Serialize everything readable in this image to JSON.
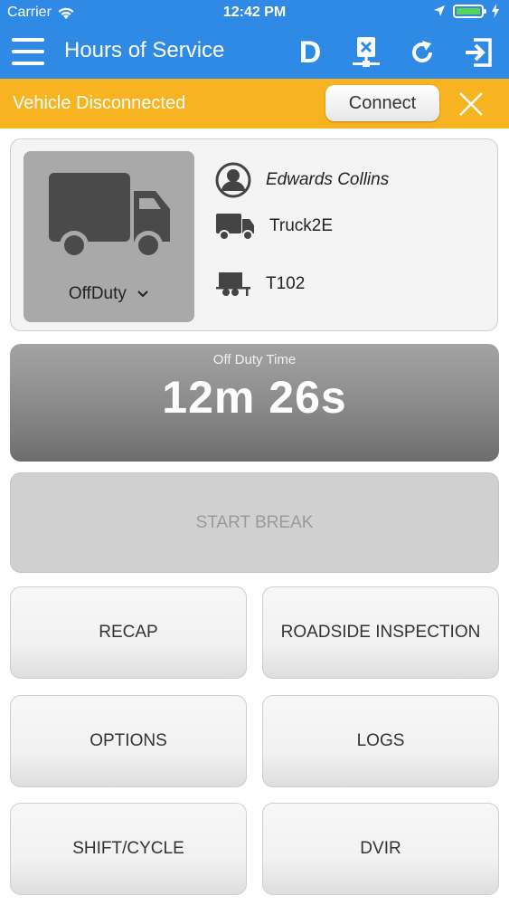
{
  "status_bar": {
    "carrier": "Carrier",
    "time": "12:42 PM",
    "battery_level": 1.0,
    "battery_color": "#5ad35a"
  },
  "app_bar": {
    "title": "Hours of Service",
    "driver_letter": "D",
    "icons": [
      "menu-icon",
      "network-disconnected-icon",
      "refresh-icon",
      "logout-icon"
    ],
    "color": "#2f8ae6"
  },
  "banner": {
    "message": "Vehicle Disconnected",
    "connect_label": "Connect",
    "color": "#f8b321"
  },
  "driver_card": {
    "duty_status": "OffDuty",
    "driver_name": "Edwards Collins",
    "truck": "Truck2E",
    "trailer": "T102"
  },
  "timer": {
    "label": "Off Duty Time",
    "value": "12m 26s"
  },
  "actions": {
    "start_break": "START BREAK",
    "recap": "RECAP",
    "roadside_inspection": "ROADSIDE INSPECTION",
    "options": "OPTIONS",
    "logs": "LOGS",
    "shift_cycle": "SHIFT/CYCLE",
    "dvir": "DVIR"
  }
}
